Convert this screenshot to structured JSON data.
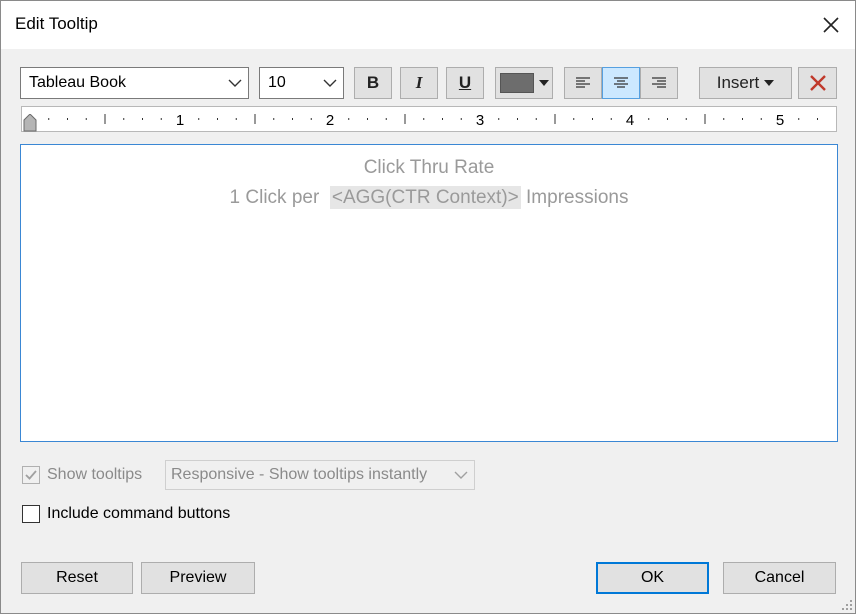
{
  "window": {
    "title": "Edit Tooltip"
  },
  "toolbar": {
    "font_family": "Tableau Book",
    "font_size": "10",
    "bold_label": "B",
    "italic_label": "I",
    "underline_label": "U",
    "text_color": "#6d6d6d",
    "insert_label": "Insert",
    "clear_color": "#c0392b"
  },
  "ruler": {
    "labels": [
      "1",
      "2",
      "3",
      "4",
      "5"
    ]
  },
  "editor": {
    "line1": "Click Thru Rate",
    "line2_prefix": "1 Click per",
    "line2_field": "<AGG(CTR Context)>",
    "line2_suffix": "Impressions"
  },
  "options": {
    "show_tooltips_label": "Show tooltips",
    "show_tooltips_checked": true,
    "tooltip_mode": "Responsive - Show tooltips instantly",
    "include_buttons_label": "Include command buttons",
    "include_buttons_checked": false
  },
  "buttons": {
    "reset": "Reset",
    "preview": "Preview",
    "ok": "OK",
    "cancel": "Cancel"
  }
}
